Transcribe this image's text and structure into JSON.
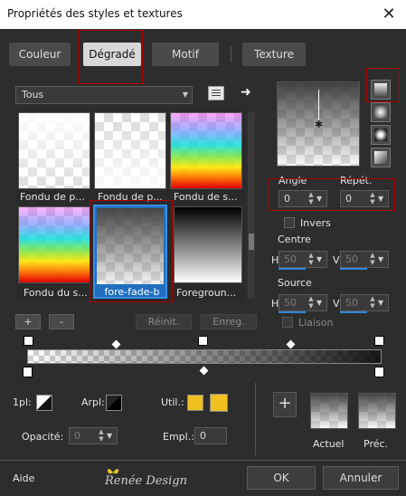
{
  "window": {
    "title": "Propriétés des styles et textures",
    "close": "✕"
  },
  "tabs": [
    "Couleur",
    "Dégradé",
    "Motif",
    "Texture"
  ],
  "category": "Tous",
  "gradients": [
    {
      "label": "Fondu de p..."
    },
    {
      "label": "Fondu de p..."
    },
    {
      "label": "Fondu de s..."
    },
    {
      "label": "Fondu du s..."
    },
    {
      "label": "fore-fade-b"
    },
    {
      "label": "Foregroun..."
    }
  ],
  "buttons": {
    "add": "+",
    "remove": "-",
    "reset": "Réinit.",
    "save": "Enreg.",
    "ok": "OK",
    "cancel": "Annuler",
    "help": "Aide",
    "add_style": "+"
  },
  "angle": {
    "label": "Angle",
    "value": "0"
  },
  "repeat": {
    "label": "Répét.",
    "value": "0"
  },
  "invert": {
    "label": "Invers"
  },
  "center": {
    "label": "Centre",
    "h_label": "H",
    "h": "50",
    "v_label": "V",
    "v": "50"
  },
  "source": {
    "label": "Source",
    "h_label": "H",
    "h": "50",
    "v_label": "V",
    "v": "50"
  },
  "link": {
    "label": "Liaison"
  },
  "bottom": {
    "first_plan": "1pl:",
    "back_plan": "Arpl:",
    "user": "Util.:",
    "opacity_label": "Opacité:",
    "opacity": "0",
    "location_label": "Empl.:",
    "location": "0",
    "current": "Actuel",
    "previous": "Préc.",
    "user_color": "#f0c020"
  },
  "watermark": "Renée Design"
}
